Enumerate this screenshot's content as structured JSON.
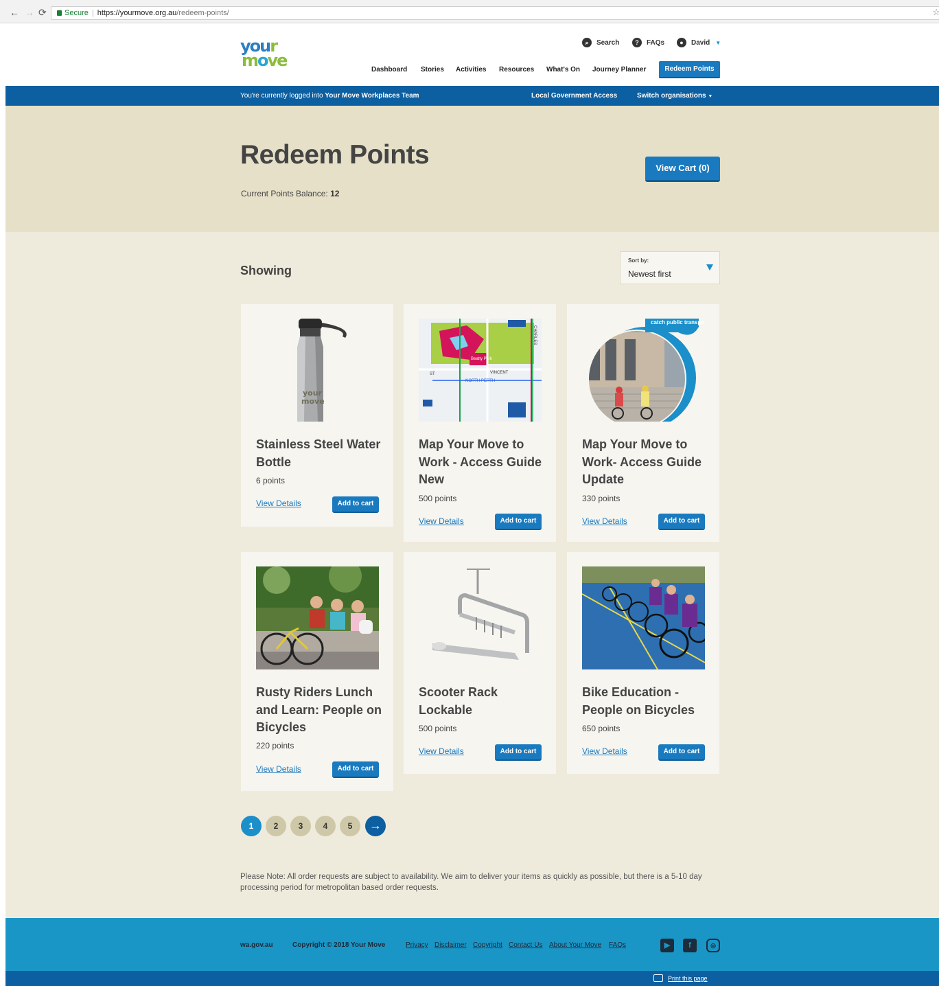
{
  "browser": {
    "secure_label": "Secure",
    "url_host": "https://yourmove.org.au",
    "url_path": "/redeem-points/"
  },
  "header": {
    "logo_top": "your",
    "logo_bottom": "move",
    "util": {
      "search": "Search",
      "faqs": "FAQs",
      "user": "David"
    },
    "nav": [
      "Dashboard",
      "Stories",
      "Activities",
      "Resources",
      "What's On",
      "Journey Planner"
    ],
    "redeem": "Redeem Points"
  },
  "bluebar": {
    "logged_prefix": "You're currently logged into ",
    "team": "Your Move Workplaces Team",
    "lga": "Local Government Access",
    "switch": "Switch organisations"
  },
  "hero": {
    "title": "Redeem Points",
    "balance_label": "Current Points Balance: ",
    "balance_value": "12",
    "view_cart": "View Cart (0)"
  },
  "listing": {
    "showing": "Showing",
    "sort_label": "Sort by:",
    "sort_value": "Newest first"
  },
  "products": [
    {
      "title": "Stainless Steel Water Bottle",
      "points": "6 points",
      "view": "View Details",
      "add": "Add to cart",
      "image": "water-bottle"
    },
    {
      "title": "Map Your Move to Work - Access Guide New",
      "points": "500 points",
      "view": "View Details",
      "add": "Add to cart",
      "image": "access-map"
    },
    {
      "title": "Map Your Move to Work- Access Guide Update",
      "points": "330 points",
      "view": "View Details",
      "add": "Add to cart",
      "image": "catch-public-transport"
    },
    {
      "title": "Rusty Riders Lunch and Learn: People on Bicycles",
      "points": "220 points",
      "view": "View Details",
      "add": "Add to cart",
      "image": "riders-photo"
    },
    {
      "title": "Scooter Rack Lockable",
      "points": "500 points",
      "view": "View Details",
      "add": "Add to cart",
      "image": "scooter-rack"
    },
    {
      "title": "Bike Education - People on Bicycles",
      "points": "650 points",
      "view": "View Details",
      "add": "Add to cart",
      "image": "bike-education-photo"
    }
  ],
  "map_labels": {
    "park": "Beatty Park",
    "street1": "VINCENT",
    "street2": "CHARLES",
    "suburb": "NORTH PERTH",
    "st": "ST",
    "badge": "catch public transport"
  },
  "pagination": [
    "1",
    "2",
    "3",
    "4",
    "5"
  ],
  "note": "Please Note: All order requests are subject to availability. We aim to deliver your items as quickly as possible, but there is a 5-10 day processing period for metropolitan based order requests.",
  "footer": {
    "gov": "wa.gov.au",
    "copyright": "Copyright © 2018 Your Move",
    "links": [
      "Privacy",
      "Disclaimer",
      "Copyright",
      "Contact Us",
      "About Your Move",
      "FAQs"
    ],
    "print": "Print this page"
  },
  "colors": {
    "primary_blue": "#1a7abf",
    "dark_blue": "#0c5fa0",
    "footer_blue": "#1a96c6",
    "hero_beige": "#e6e0c8",
    "content_beige": "#efebdc"
  }
}
